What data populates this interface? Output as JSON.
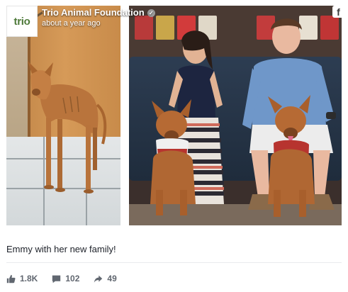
{
  "header": {
    "avatar_text": "trio",
    "page_name": "Trio Animal Foundation",
    "timestamp": "about a year ago",
    "verified_icon": "checkmark-circle-icon"
  },
  "platform_icon": "f",
  "caption": "Emmy with her new family!",
  "stats": {
    "likes": "1.8K",
    "comments": "102",
    "shares": "49"
  },
  "colors": {
    "text_dark": "#1d2129",
    "text_muted": "#616770",
    "divider": "#e9ebee",
    "avatar_green": "#4e7a3a"
  }
}
